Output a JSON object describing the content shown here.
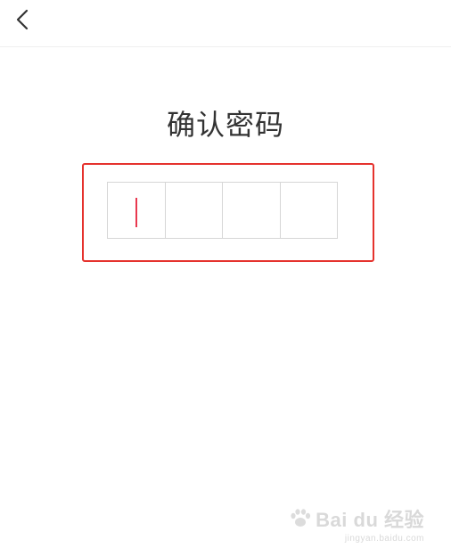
{
  "header": {
    "back_icon": "chevron-left-icon"
  },
  "page": {
    "title": "确认密码"
  },
  "pin": {
    "length": 4,
    "digits": [
      "",
      "",
      "",
      ""
    ],
    "active_index": 0
  },
  "colors": {
    "highlight_frame": "#e5322d",
    "caret": "#e8384f",
    "box_border": "#d6d6d6",
    "title_text": "#333333"
  },
  "watermark": {
    "logo_text": "Bai du 经验",
    "url": "jingyan.baidu.com"
  }
}
